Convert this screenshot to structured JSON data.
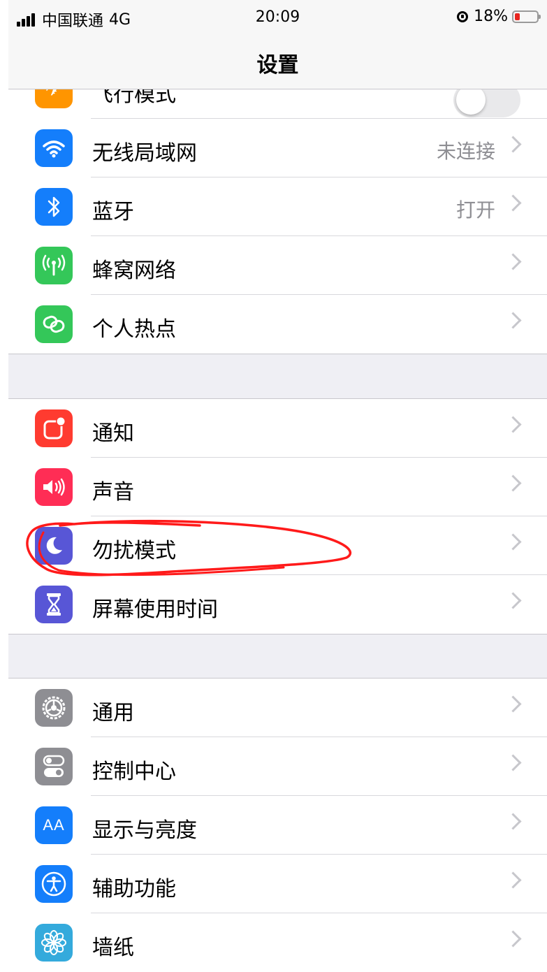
{
  "status": {
    "carrier": "中国联通",
    "network": "4G",
    "time": "20:09",
    "battery": "18%",
    "battery_level": 0.18
  },
  "nav": {
    "title": "设置"
  },
  "group0": {
    "rows": [
      {
        "label": "飞行模式",
        "icon": "airplane-icon",
        "color": "#ff9500",
        "toggle": false
      }
    ]
  },
  "group1": {
    "rows": [
      {
        "label": "无线局域网",
        "value": "未连接",
        "icon": "wifi-icon",
        "color": "#147efb"
      },
      {
        "label": "蓝牙",
        "value": "打开",
        "icon": "bluetooth-icon",
        "color": "#147efb"
      },
      {
        "label": "蜂窝网络",
        "icon": "cellular-antenna-icon",
        "color": "#34c759"
      },
      {
        "label": "个人热点",
        "icon": "hotspot-link-icon",
        "color": "#34c759"
      }
    ]
  },
  "group2": {
    "rows": [
      {
        "label": "通知",
        "icon": "notifications-icon",
        "color": "#ff3b30"
      },
      {
        "label": "声音",
        "icon": "speaker-icon",
        "color": "#ff2d55"
      },
      {
        "label": "勿扰模式",
        "icon": "moon-icon",
        "color": "#5856d6"
      },
      {
        "label": "屏幕使用时间",
        "icon": "hourglass-icon",
        "color": "#5856d6"
      }
    ]
  },
  "group3": {
    "rows": [
      {
        "label": "通用",
        "icon": "gear-icon",
        "color": "#8e8e93"
      },
      {
        "label": "控制中心",
        "icon": "toggles-icon",
        "color": "#8e8e93"
      },
      {
        "label": "显示与亮度",
        "icon": "text-size-icon",
        "icon_text": "AA",
        "color": "#147efb"
      },
      {
        "label": "辅助功能",
        "icon": "accessibility-icon",
        "color": "#147efb"
      },
      {
        "label": "墙纸",
        "icon": "wallpaper-flower-icon",
        "color": "#34aadc"
      }
    ]
  },
  "annotation": {
    "color": "#ff1a1a",
    "target": "勿扰模式"
  }
}
